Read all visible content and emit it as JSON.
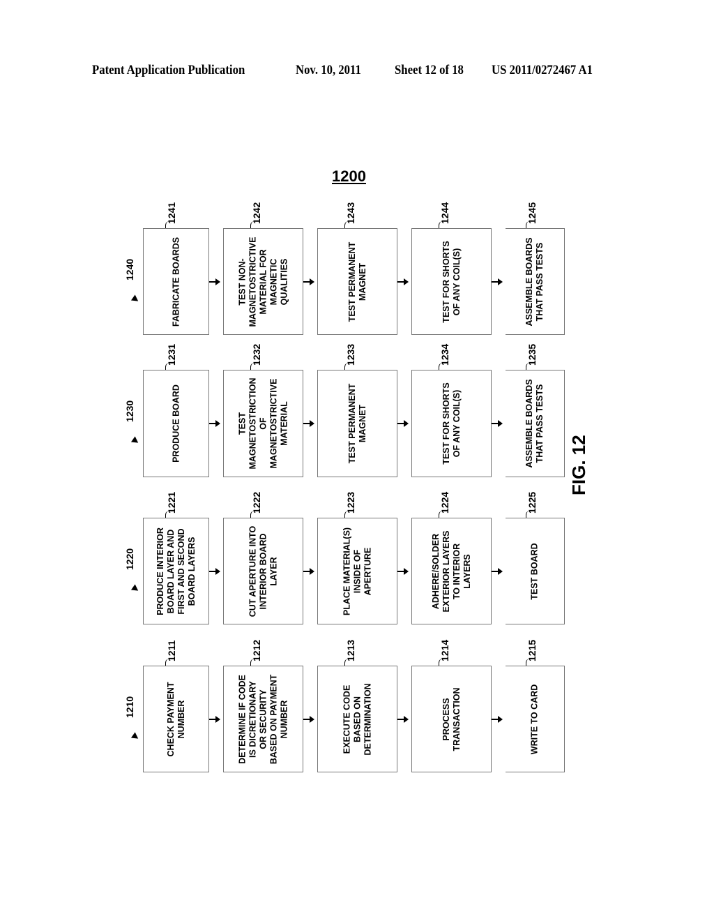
{
  "header": {
    "publication": "Patent Application Publication",
    "date": "Nov. 10, 2011",
    "sheet": "Sheet 12 of 18",
    "number": "US 2011/0272467 A1"
  },
  "figure_number": "1200",
  "figure_label": "FIG. 12",
  "groups": [
    {
      "ref": "1240",
      "steps": [
        {
          "ref": "1241",
          "text": "FABRICATE BOARDS"
        },
        {
          "ref": "1242",
          "text": "TEST NON-\nMAGNETOSTRICTIVE\nMATERIAL FOR\nMAGNETIC\nQUALITIES"
        },
        {
          "ref": "1243",
          "text": "TEST PERMANENT\nMAGNET"
        },
        {
          "ref": "1244",
          "text": "TEST FOR SHORTS\nOF ANY COIL(S)"
        },
        {
          "ref": "1245",
          "text": "ASSEMBLE BOARDS\nTHAT PASS TESTS"
        }
      ]
    },
    {
      "ref": "1230",
      "steps": [
        {
          "ref": "1231",
          "text": "PRODUCE BOARD"
        },
        {
          "ref": "1232",
          "text": "TEST\nMAGNETOSTRICTION\nOF\nMAGNETOSTRICTIVE\nMATERIAL"
        },
        {
          "ref": "1233",
          "text": "TEST PERMANENT\nMAGNET"
        },
        {
          "ref": "1234",
          "text": "TEST FOR SHORTS\nOF ANY COIL(S)"
        },
        {
          "ref": "1235",
          "text": "ASSEMBLE BOARDS\nTHAT PASS TESTS"
        }
      ]
    },
    {
      "ref": "1220",
      "steps": [
        {
          "ref": "1221",
          "text": "PRODUCE INTERIOR\nBOARD LAYER AND\nFIRST AND SECOND\nBOARD LAYERS"
        },
        {
          "ref": "1222",
          "text": "CUT APERTURE INTO\nINTERIOR BOARD\nLAYER"
        },
        {
          "ref": "1223",
          "text": "PLACE MATERIAL(S)\nINSIDE OF\nAPERTURE"
        },
        {
          "ref": "1224",
          "text": "ADHERE/SOLDER\nEXTERIOR LAYERS\nTO INTERIOR\nLAYERS"
        },
        {
          "ref": "1225",
          "text": "TEST BOARD"
        }
      ]
    },
    {
      "ref": "1210",
      "steps": [
        {
          "ref": "1211",
          "text": "CHECK PAYMENT\nNUMBER"
        },
        {
          "ref": "1212",
          "text": "DETERMINE IF CODE\nIS DICRETIONARY\nOR SECURITY\nBASED ON PAYMENT\nNUMBER"
        },
        {
          "ref": "1213",
          "text": "EXECUTE CODE\nBASED ON\nDETERMINATION"
        },
        {
          "ref": "1214",
          "text": "PROCESS\nTRANSACTION"
        },
        {
          "ref": "1215",
          "text": "WRITE TO CARD"
        }
      ]
    }
  ]
}
